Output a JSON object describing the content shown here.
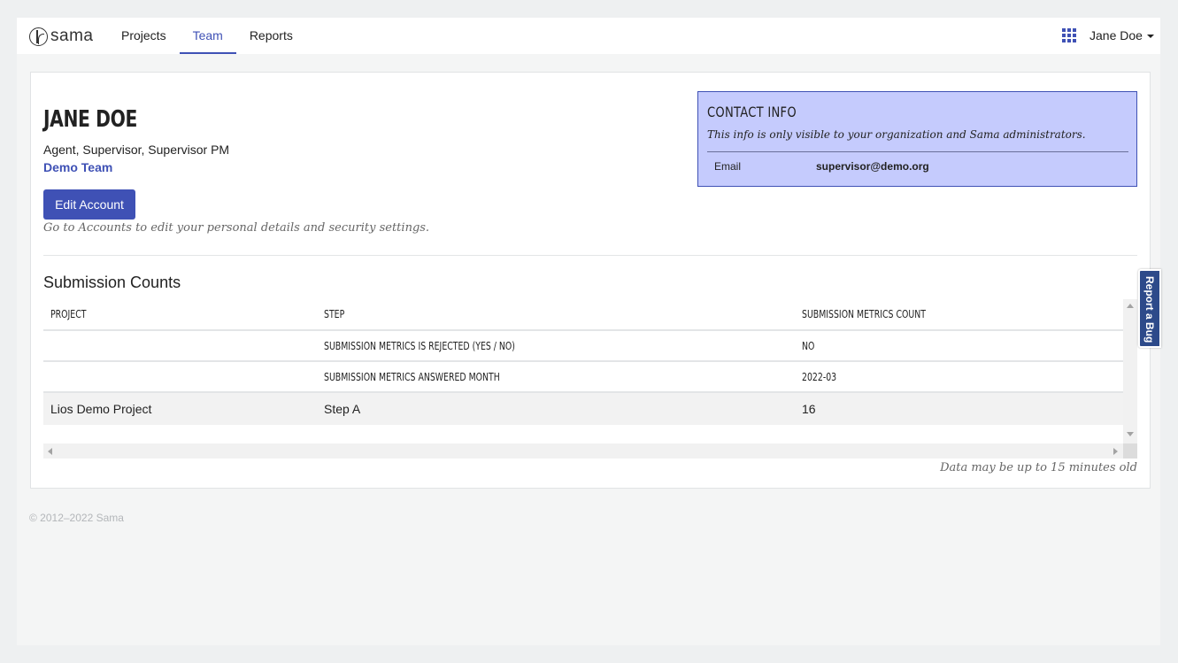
{
  "header": {
    "logo_text": "sama",
    "tabs": [
      {
        "label": "Projects",
        "active": false
      },
      {
        "label": "Team",
        "active": true
      },
      {
        "label": "Reports",
        "active": false
      }
    ],
    "apps_icon": "grid-apps-icon",
    "user_name": "Jane Doe"
  },
  "profile": {
    "name": "JANE DOE",
    "roles": "Agent, Supervisor, Supervisor PM",
    "team": "Demo Team",
    "edit_button": "Edit Account",
    "edit_hint": "Go to Accounts to edit your personal details and security settings."
  },
  "contact": {
    "title": "CONTACT INFO",
    "note": "This info is only visible to your organization and Sama administrators.",
    "email_label": "Email",
    "email_value": "supervisor@demo.org"
  },
  "submissions": {
    "title": "Submission Counts",
    "columns": [
      "PROJECT",
      "STEP",
      "SUBMISSION METRICS COUNT"
    ],
    "meta_rows": [
      {
        "project": "",
        "step": "SUBMISSION METRICS IS REJECTED (YES / NO)",
        "count": "NO"
      },
      {
        "project": "",
        "step": "SUBMISSION METRICS ANSWERED MONTH",
        "count": "2022-03"
      }
    ],
    "data_rows": [
      {
        "project": "Lios Demo Project",
        "step": "Step A",
        "count": "16"
      }
    ],
    "data_age_note": "Data may be up to 15 minutes old"
  },
  "footer": {
    "copyright": "© 2012–2022 Sama"
  },
  "report_bug": "Report a Bug",
  "colors": {
    "accent": "#3f51b5",
    "contact_bg": "#c5cbfd",
    "report_bug_bg": "#2d4a8a"
  }
}
